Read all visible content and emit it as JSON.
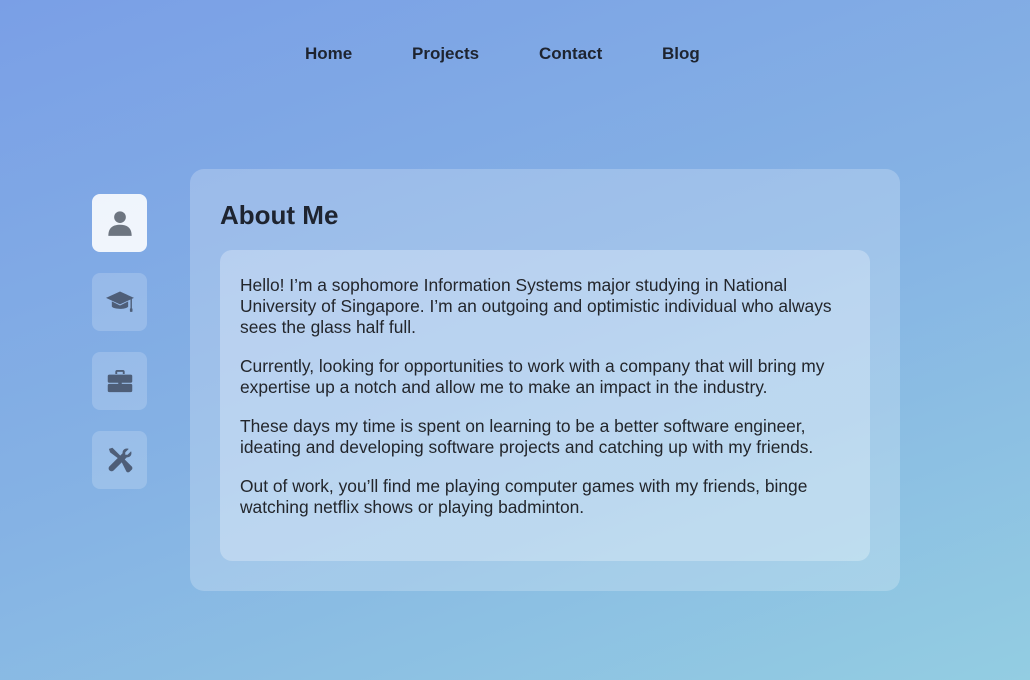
{
  "nav": {
    "home": "Home",
    "projects": "Projects",
    "contact": "Contact",
    "blog": "Blog"
  },
  "sidebar": {
    "items": [
      {
        "icon": "user-icon",
        "active": true
      },
      {
        "icon": "graduation-cap-icon",
        "active": false
      },
      {
        "icon": "briefcase-icon",
        "active": false
      },
      {
        "icon": "tools-icon",
        "active": false
      }
    ]
  },
  "about": {
    "title": "About Me",
    "paragraphs": [
      "Hello! I’m a sophomore Information Systems major studying in National University of Singapore. I’m an outgoing and optimistic individual who always sees the glass half full.",
      "Currently, looking for opportunities to work with a company that will bring my expertise up a notch and allow me to make an impact in the industry.",
      "These days my time is spent on learning to be a better software engineer, ideating and developing software projects and catching up with my friends.",
      "Out of work, you’ll find me playing computer games with my friends, binge watching netflix shows or playing badminton."
    ]
  }
}
